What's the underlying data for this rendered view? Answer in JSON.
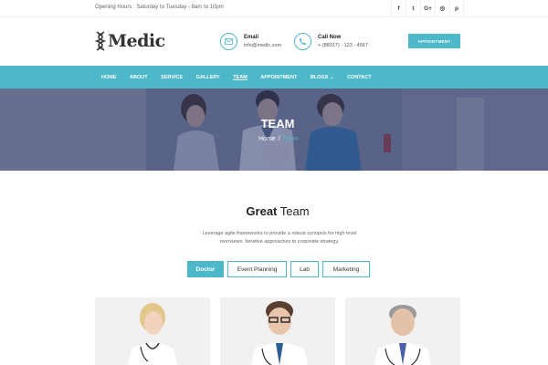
{
  "topbar": {
    "hours": "Opening Hours : Saturday to Tuesday - 8am to 10pm",
    "socials": [
      {
        "icon": "facebook-icon",
        "glyph": "f"
      },
      {
        "icon": "twitter-icon",
        "glyph": "t"
      },
      {
        "icon": "google-plus-icon",
        "glyph": "G+"
      },
      {
        "icon": "instagram-icon",
        "glyph": "◎"
      },
      {
        "icon": "pinterest-icon",
        "glyph": "p"
      }
    ]
  },
  "header": {
    "logo_text": "Medic",
    "email": {
      "title": "Email",
      "value": "info@medic.com"
    },
    "phone": {
      "title": "Call Now",
      "value": "+ (88017) - 123 - 4567"
    },
    "appointment_label": "APPOINTMENT"
  },
  "nav": {
    "items": [
      {
        "label": "HOME"
      },
      {
        "label": "ABOUT"
      },
      {
        "label": "SERVICE"
      },
      {
        "label": "GALLERY"
      },
      {
        "label": "TEAM"
      },
      {
        "label": "APPOINTMENT"
      },
      {
        "label": "BLOGS"
      },
      {
        "label": "CONTACT"
      }
    ],
    "active_index": 4
  },
  "banner": {
    "title": "TEAM",
    "breadcrumb_home": "Home",
    "breadcrumb_sep": "/",
    "breadcrumb_current": "Team"
  },
  "section": {
    "title_bold": "Great",
    "title_rest": " Team",
    "description": "Leverage agile frameworks to provide a robust synopsis for high level overviews. Iterative approaches to corporate strategy."
  },
  "filters": [
    "Doctor",
    "Event Planning",
    "Lab",
    "Marketing"
  ],
  "colors": {
    "accent": "#4db8c7",
    "text_dark": "#222222",
    "card_bg": "#f1f1f1"
  }
}
